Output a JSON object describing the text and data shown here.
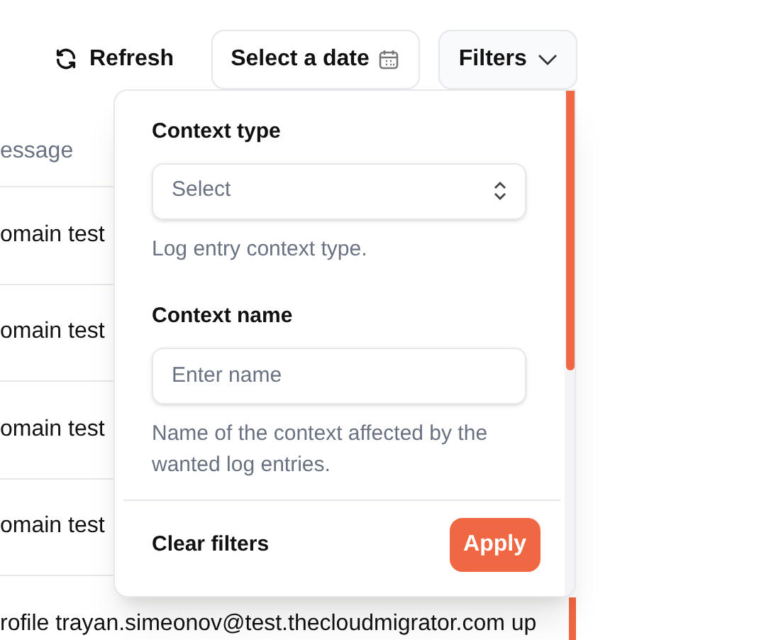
{
  "toolbar": {
    "refresh": "Refresh",
    "date_picker": "Select a date",
    "filters": "Filters"
  },
  "table": {
    "column_header": "essage",
    "rows": [
      "omain test",
      "omain test",
      "omain test",
      "omain test",
      "rofile trayan.simeonov@test.thecloudmigrator.com up"
    ]
  },
  "filters_popover": {
    "context_type": {
      "label": "Context type",
      "placeholder": "Select",
      "hint": "Log entry context type."
    },
    "context_name": {
      "label": "Context name",
      "placeholder": "Enter name",
      "hint": "Name of the context affected by the wanted log entries."
    },
    "clear": "Clear filters",
    "apply": "Apply"
  }
}
